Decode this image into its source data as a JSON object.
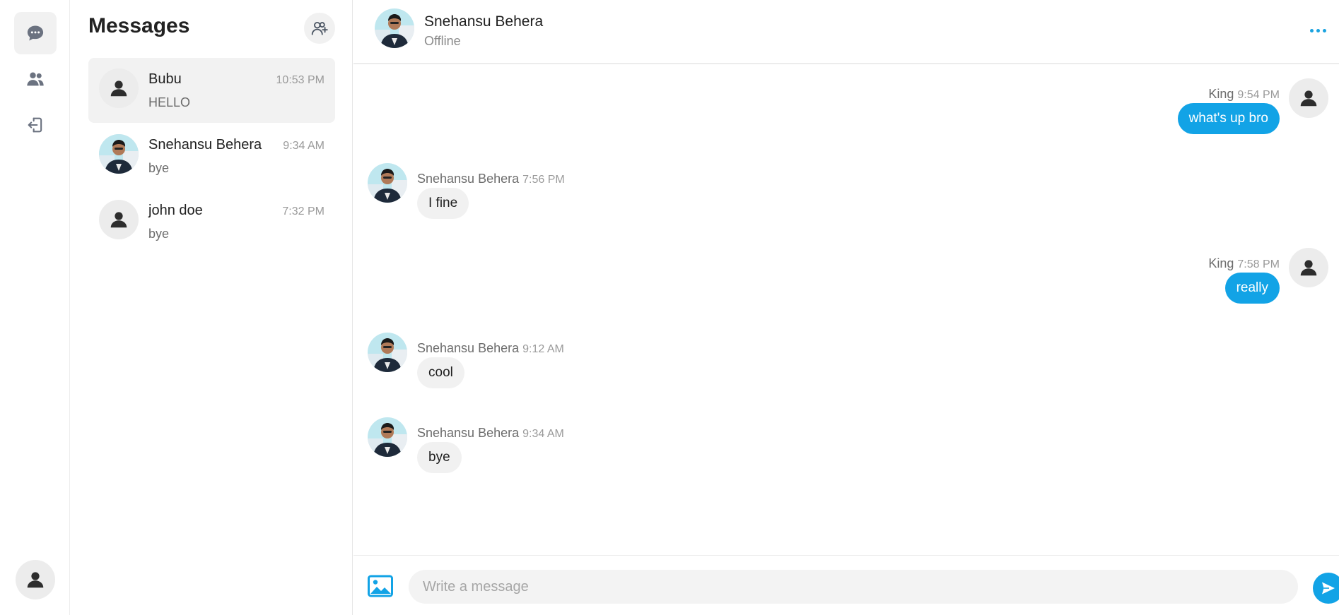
{
  "rail": {
    "items": [
      {
        "icon": "chat-icon",
        "active": true
      },
      {
        "icon": "users-icon",
        "active": false
      },
      {
        "icon": "logout-icon",
        "active": false
      }
    ],
    "profile_icon": "user-icon"
  },
  "list": {
    "title": "Messages",
    "add_icon": "add-user-icon",
    "conversations": [
      {
        "name": "Bubu",
        "time": "10:53 PM",
        "preview": "HELLO",
        "avatar": "default",
        "active": true
      },
      {
        "name": "Snehansu Behera",
        "time": "9:34 AM",
        "preview": "bye",
        "avatar": "photo",
        "active": false
      },
      {
        "name": "john doe",
        "time": "7:32 PM",
        "preview": "bye",
        "avatar": "default",
        "active": false
      }
    ]
  },
  "chat": {
    "header": {
      "name": "Snehansu Behera",
      "status": "Offline",
      "more_icon": "more-icon"
    },
    "messages": [
      {
        "direction": "out",
        "sender": "King",
        "time": "9:54 PM",
        "text": "what's up bro"
      },
      {
        "direction": "in",
        "sender": "Snehansu Behera",
        "time": "7:56 PM",
        "text": "I fine"
      },
      {
        "direction": "out",
        "sender": "King",
        "time": "7:58 PM",
        "text": "really"
      },
      {
        "direction": "in",
        "sender": "Snehansu Behera",
        "time": "9:12 AM",
        "text": "cool"
      },
      {
        "direction": "in",
        "sender": "Snehansu Behera",
        "time": "9:34 AM",
        "text": "bye"
      }
    ],
    "composer": {
      "placeholder": "Write a message",
      "value": "",
      "image_icon": "image-icon",
      "send_icon": "send-icon"
    }
  },
  "colors": {
    "accent": "#12a3e6",
    "bubble_in": "#f1f1f1",
    "muted": "#9a9a9a"
  }
}
